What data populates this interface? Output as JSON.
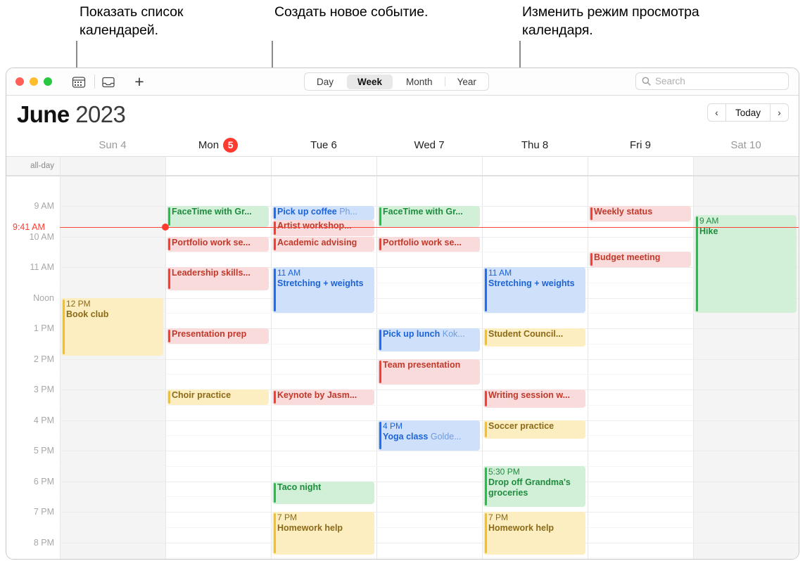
{
  "callouts": [
    {
      "id": "show-calendar-list",
      "text": "Показать список календарей."
    },
    {
      "id": "create-new-event",
      "text": "Создать новое событие."
    },
    {
      "id": "change-view-mode",
      "text": "Изменить режим просмотра календаря."
    }
  ],
  "toolbar": {
    "calendar_list_icon": "calendar-icon",
    "inbox_icon": "inbox-icon",
    "new_event_label": "+",
    "views": [
      {
        "label": "Day",
        "active": false
      },
      {
        "label": "Week",
        "active": true
      },
      {
        "label": "Month",
        "active": false
      },
      {
        "label": "Year",
        "active": false
      }
    ],
    "search": {
      "placeholder": "Search",
      "value": ""
    }
  },
  "header": {
    "month": "June",
    "year": "2023",
    "prev_label": "‹",
    "today_label": "Today",
    "next_label": "›"
  },
  "days": [
    {
      "label": "Sun 4",
      "weekend": true,
      "today": false
    },
    {
      "label": "Mon",
      "badge": "5",
      "weekend": false,
      "today": true
    },
    {
      "label": "Tue 6",
      "weekend": false,
      "today": false
    },
    {
      "label": "Wed 7",
      "weekend": false,
      "today": false
    },
    {
      "label": "Thu 8",
      "weekend": false,
      "today": false
    },
    {
      "label": "Fri 9",
      "weekend": false,
      "today": false
    },
    {
      "label": "Sat 10",
      "weekend": true,
      "today": false
    }
  ],
  "allday_label": "all-day",
  "time_labels": [
    "9 AM",
    "10 AM",
    "11 AM",
    "Noon",
    "1 PM",
    "2 PM",
    "3 PM",
    "4 PM",
    "5 PM",
    "6 PM",
    "7 PM",
    "8 PM"
  ],
  "now": {
    "label": "9:41 AM",
    "color": "#ff3b30"
  },
  "colors": {
    "red": "#ff3b30",
    "blue": "#1d6ef5",
    "green": "#21c04a",
    "yellow": "#f5c026",
    "today_badge": "#ff3b30",
    "accent": "#ff453a"
  },
  "events": [
    {
      "day": 1,
      "title": "FaceTime with Gr...",
      "time": "",
      "location": "",
      "color": "green",
      "start": 9.0,
      "end": 9.7,
      "wrap": false
    },
    {
      "day": 1,
      "title": "Portfolio work se...",
      "time": "",
      "location": "",
      "color": "red",
      "start": 10.0,
      "end": 10.5,
      "wrap": false
    },
    {
      "day": 1,
      "title": "Leadership skills...",
      "time": "",
      "location": "",
      "color": "red",
      "start": 11.0,
      "end": 11.75,
      "wrap": false
    },
    {
      "day": 1,
      "title": "Presentation prep",
      "time": "",
      "location": "",
      "color": "red",
      "start": 13.0,
      "end": 13.5,
      "wrap": false
    },
    {
      "day": 1,
      "title": "Choir practice",
      "time": "",
      "location": "",
      "color": "yellow",
      "start": 15.0,
      "end": 15.5,
      "wrap": false
    },
    {
      "day": 2,
      "title": "Pick up coffee",
      "time": "",
      "location": "Ph...",
      "color": "blue",
      "start": 9.0,
      "end": 9.45,
      "wrap": false
    },
    {
      "day": 2,
      "title": "Artist workshop...",
      "time": "",
      "location": "",
      "color": "red",
      "start": 9.45,
      "end": 10.0,
      "wrap": false
    },
    {
      "day": 2,
      "title": "Academic advising",
      "time": "",
      "location": "",
      "color": "red",
      "start": 10.0,
      "end": 10.5,
      "wrap": false
    },
    {
      "day": 2,
      "title": "Stretching +  weights",
      "time": "11 AM",
      "location": "",
      "color": "blue",
      "start": 11.0,
      "end": 12.5,
      "wrap": true
    },
    {
      "day": 2,
      "title": "Keynote by Jasm...",
      "time": "",
      "location": "",
      "color": "red",
      "start": 15.0,
      "end": 15.5,
      "wrap": false
    },
    {
      "day": 2,
      "title": "Taco night",
      "time": "",
      "location": "",
      "color": "green",
      "start": 18.0,
      "end": 18.75,
      "wrap": false
    },
    {
      "day": 2,
      "title": "Homework help",
      "time": "7 PM",
      "location": "",
      "color": "yellow",
      "start": 19.0,
      "end": 20.4,
      "wrap": false
    },
    {
      "day": 3,
      "title": "FaceTime with Gr...",
      "time": "",
      "location": "",
      "color": "green",
      "start": 9.0,
      "end": 9.7,
      "wrap": false
    },
    {
      "day": 3,
      "title": "Portfolio work se...",
      "time": "",
      "location": "",
      "color": "red",
      "start": 10.0,
      "end": 10.5,
      "wrap": false
    },
    {
      "day": 3,
      "title": "Pick up lunch",
      "time": "",
      "location": "Kok...",
      "color": "blue",
      "start": 13.0,
      "end": 13.75,
      "wrap": false
    },
    {
      "day": 3,
      "title": "Team presentation",
      "time": "",
      "location": "",
      "color": "red",
      "start": 14.0,
      "end": 14.85,
      "wrap": false
    },
    {
      "day": 3,
      "title": "Yoga class",
      "time": "4 PM",
      "location": "Golde...",
      "color": "blue",
      "start": 16.0,
      "end": 17.0,
      "wrap": false
    },
    {
      "day": 4,
      "title": "Stretching +  weights",
      "time": "11 AM",
      "location": "",
      "color": "blue",
      "start": 11.0,
      "end": 12.5,
      "wrap": true
    },
    {
      "day": 4,
      "title": "Student Council...",
      "time": "",
      "location": "",
      "color": "yellow",
      "start": 13.0,
      "end": 13.6,
      "wrap": false
    },
    {
      "day": 4,
      "title": "Writing session w...",
      "time": "",
      "location": "",
      "color": "red",
      "start": 15.0,
      "end": 15.6,
      "wrap": false
    },
    {
      "day": 4,
      "title": "Soccer practice",
      "time": "",
      "location": "",
      "color": "yellow",
      "start": 16.0,
      "end": 16.6,
      "wrap": false
    },
    {
      "day": 4,
      "title": "Drop off Grandma's  groceries",
      "time": "5:30 PM",
      "location": "",
      "color": "green",
      "start": 17.5,
      "end": 18.85,
      "wrap": true
    },
    {
      "day": 4,
      "title": "Homework help",
      "time": "7 PM",
      "location": "",
      "color": "yellow",
      "start": 19.0,
      "end": 20.4,
      "wrap": false
    },
    {
      "day": 5,
      "title": "Weekly status",
      "time": "",
      "location": "",
      "color": "red",
      "start": 9.0,
      "end": 9.5,
      "wrap": false
    },
    {
      "day": 5,
      "title": "Budget meeting",
      "time": "",
      "location": "",
      "color": "red",
      "start": 10.5,
      "end": 11.0,
      "wrap": false
    },
    {
      "day": 6,
      "title": "Hike",
      "time": "9 AM",
      "location": "",
      "color": "green",
      "start": 9.3,
      "end": 12.5,
      "wrap": false
    },
    {
      "day": 0,
      "title": "Book club",
      "time": "12 PM",
      "location": "",
      "color": "yellow",
      "start": 12.0,
      "end": 13.9,
      "wrap": false
    }
  ]
}
